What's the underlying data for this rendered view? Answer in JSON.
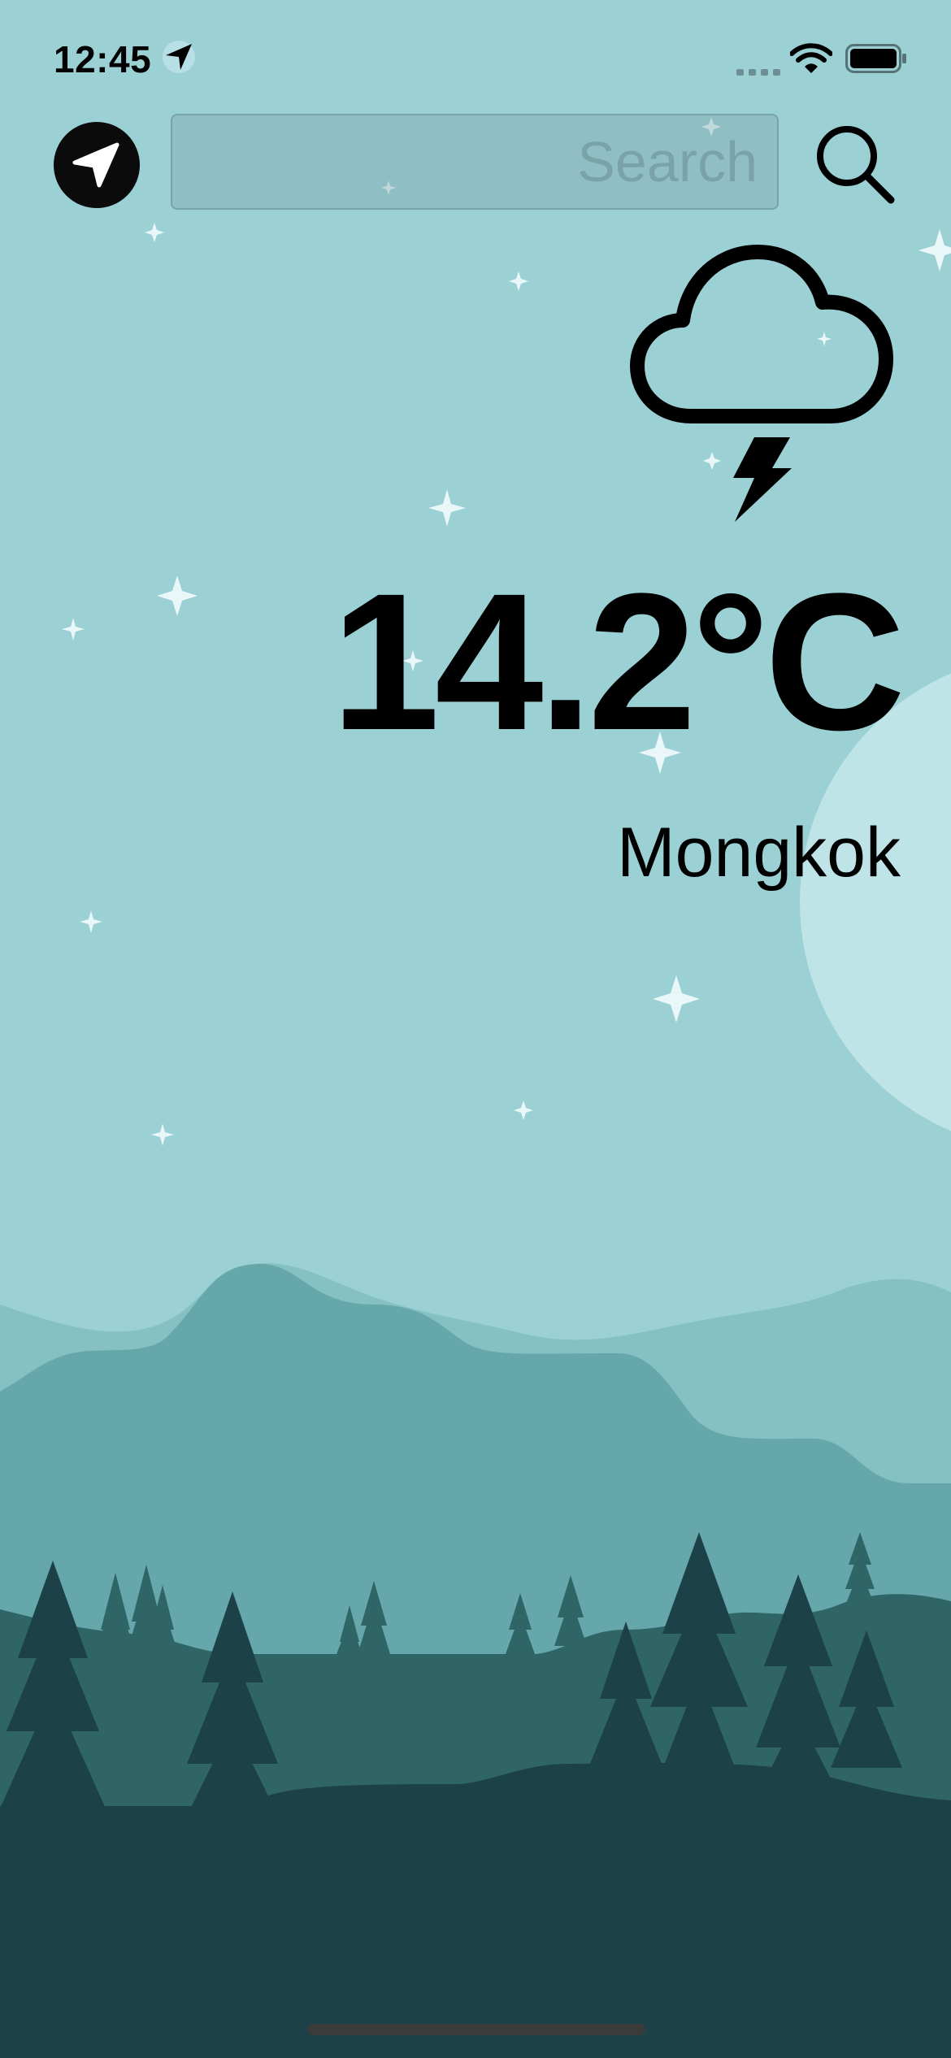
{
  "status_bar": {
    "time": "12:45",
    "icons": [
      "location-arrow-icon",
      "cellular-signal-icon",
      "wifi-icon",
      "battery-icon"
    ]
  },
  "top_bar": {
    "locate_icon": "navigation-arrow-icon",
    "search": {
      "placeholder": "Search",
      "value": ""
    },
    "search_icon": "magnifier-icon"
  },
  "weather": {
    "condition_icon": "thunderstorm-cloud-icon",
    "temperature": "14.2°C",
    "city": "Mongkok"
  },
  "colors": {
    "sky": "#9bd0d4",
    "moon": "#bee4e7",
    "stars": "#eaf7f8",
    "far_hills": "#85c0c3",
    "mid_hills": "#65a7ab",
    "near_hills": "#2f6567",
    "foreground": "#1c4148",
    "text": "#000000"
  }
}
